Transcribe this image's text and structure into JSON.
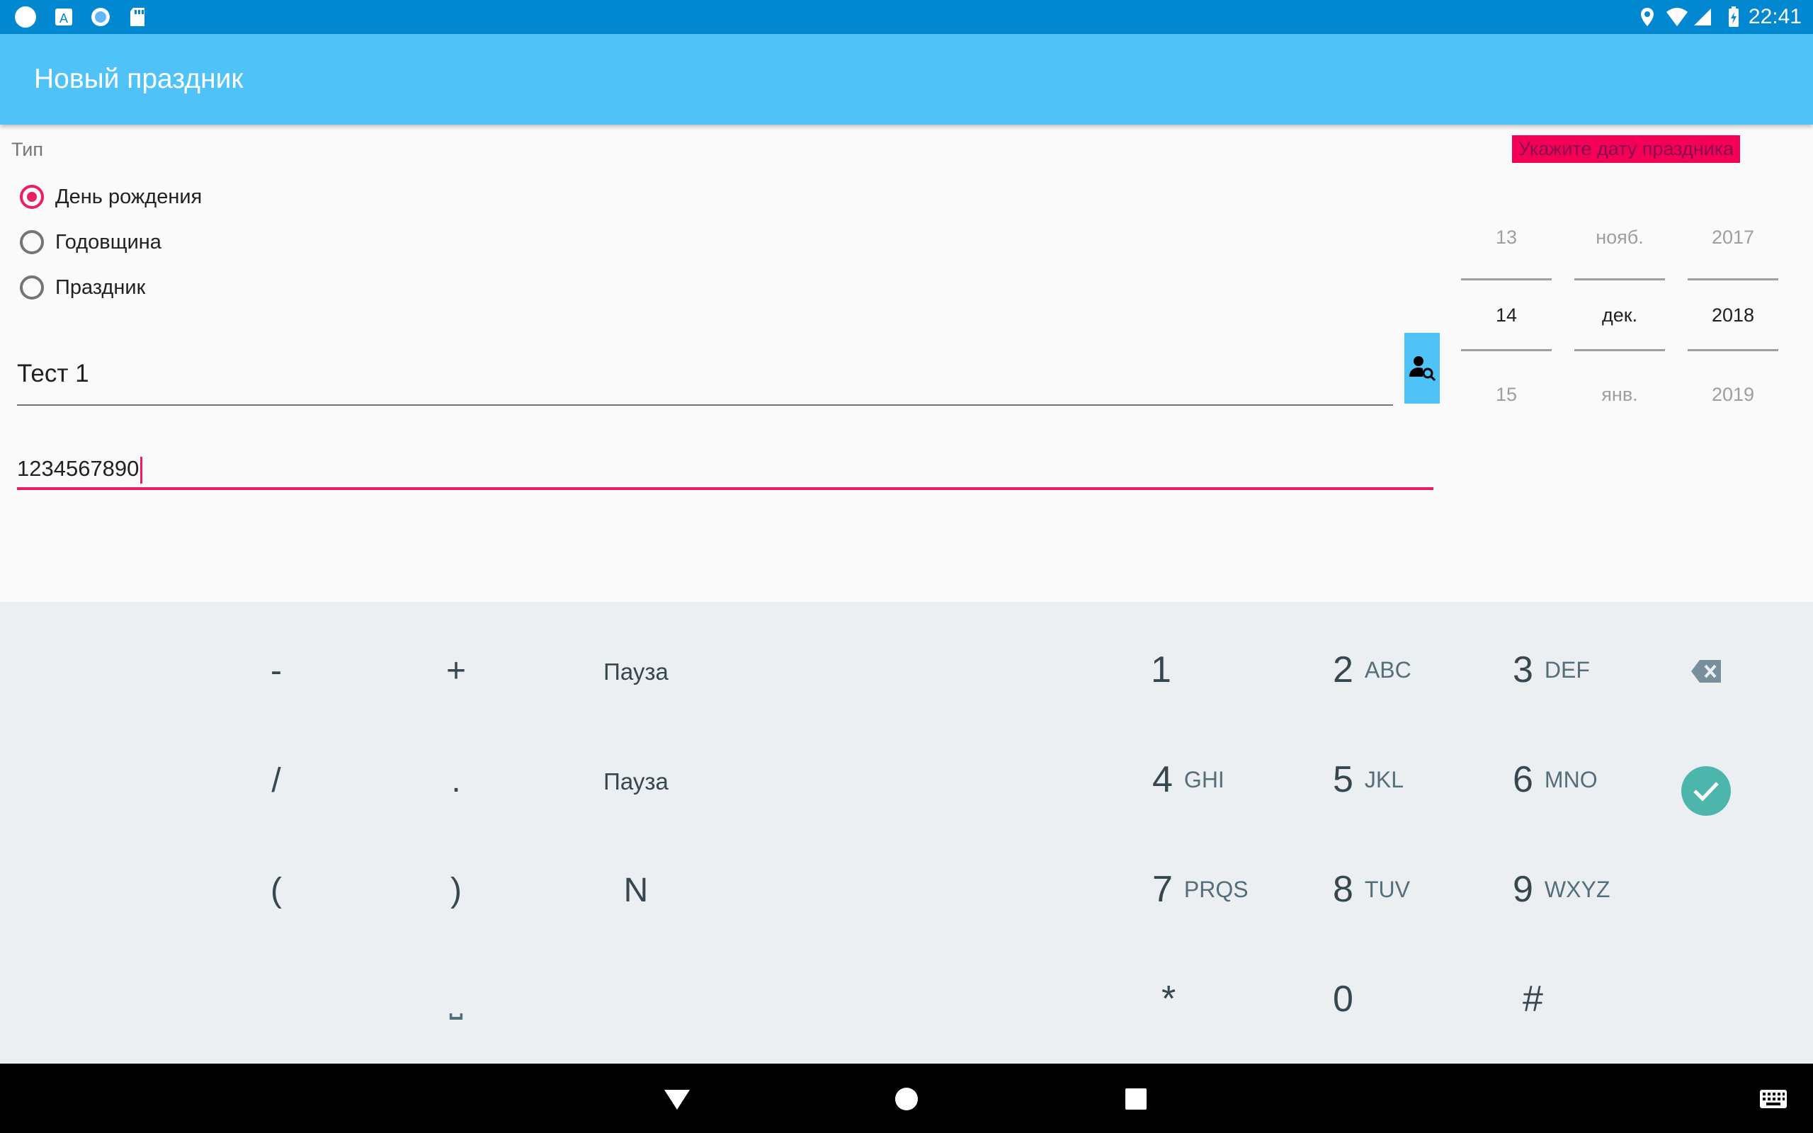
{
  "status_bar": {
    "time": "22:41",
    "left_icons": [
      "circle-notification-icon",
      "font-app-icon",
      "sync-icon",
      "sd-card-icon"
    ],
    "right_icons": [
      "location-icon",
      "wifi-icon",
      "signal-icon",
      "battery-charging-icon"
    ]
  },
  "app_bar": {
    "title": "Новый праздник",
    "color": "#4fc3f7"
  },
  "form": {
    "type_label": "Тип",
    "radio_options": [
      {
        "label": "День рождения",
        "checked": true
      },
      {
        "label": "Годовщина",
        "checked": false
      },
      {
        "label": "Праздник",
        "checked": false
      }
    ],
    "name_value": "Тест 1",
    "phone_value": "1234567890",
    "contact_button_icon": "contact-search-icon",
    "date_warning": "Укажите дату праздника"
  },
  "date_picker": {
    "day": {
      "prev": "13",
      "current": "14",
      "next": "15"
    },
    "month": {
      "prev": "нояб.",
      "current": "дек.",
      "next": "янв."
    },
    "year": {
      "prev": "2017",
      "current": "2018",
      "next": "2019"
    }
  },
  "keyboard": {
    "symbols": {
      "minus": "-",
      "plus": "+",
      "pause1": "Пауза",
      "slash": "/",
      "dot": ".",
      "pause2": "Пауза",
      "lparen": "(",
      "rparen": ")",
      "n": "N",
      "space": "⎵"
    },
    "digits": [
      {
        "d": "1",
        "l": ""
      },
      {
        "d": "2",
        "l": "ABC"
      },
      {
        "d": "3",
        "l": "DEF"
      },
      {
        "d": "4",
        "l": "GHI"
      },
      {
        "d": "5",
        "l": "JKL"
      },
      {
        "d": "6",
        "l": "MNO"
      },
      {
        "d": "7",
        "l": "PRQS"
      },
      {
        "d": "8",
        "l": "TUV"
      },
      {
        "d": "9",
        "l": "WXYZ"
      },
      {
        "d": "*",
        "l": ""
      },
      {
        "d": "0",
        "l": ""
      },
      {
        "d": "#",
        "l": ""
      }
    ],
    "backspace_icon": "backspace-icon",
    "done_icon": "check-icon"
  },
  "nav_bar": {
    "icons": [
      "back-icon",
      "home-icon",
      "recents-icon",
      "keyboard-icon"
    ]
  }
}
